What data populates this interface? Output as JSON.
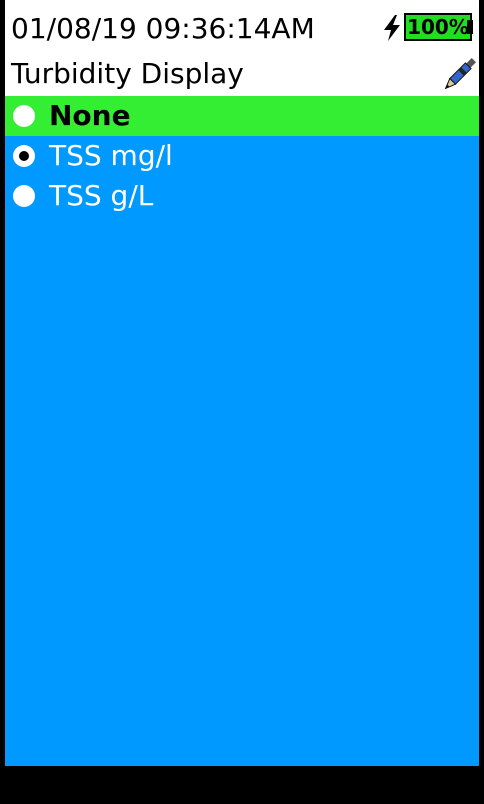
{
  "status_bar": {
    "datetime": "01/08/19 09:36:14AM",
    "battery_percent_label": "100%",
    "battery_level_fraction": 1.0,
    "charging_icon": "lightning-bolt-icon"
  },
  "header": {
    "title": "Turbidity Display",
    "edit_icon": "pen-icon"
  },
  "options": [
    {
      "label": "None",
      "checked": false,
      "highlighted": true
    },
    {
      "label": "TSS mg/l",
      "checked": true,
      "highlighted": false
    },
    {
      "label": "TSS g/L",
      "checked": false,
      "highlighted": false
    }
  ],
  "colors": {
    "content_background": "#0099ff",
    "highlight_row": "#33ee33",
    "battery_fill": "#22dd22",
    "footer": "#000000"
  }
}
